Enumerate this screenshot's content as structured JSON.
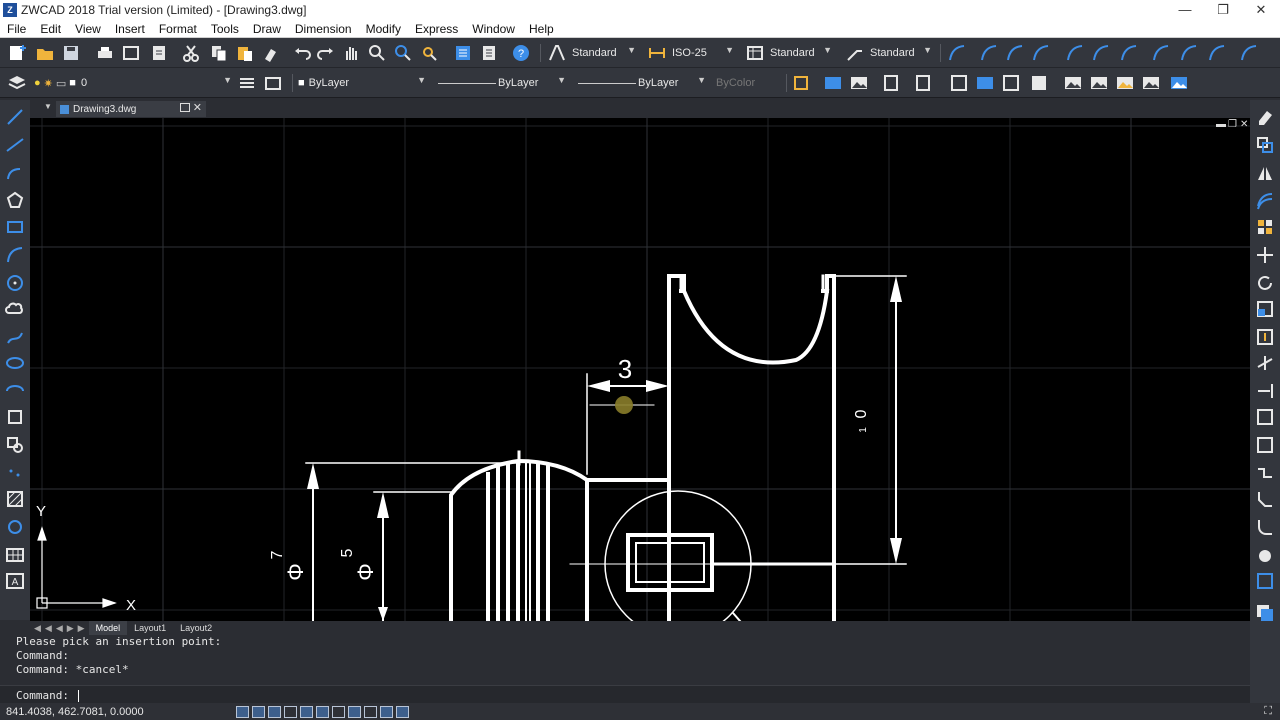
{
  "window": {
    "icon_text": "Z",
    "title": "ZWCAD 2018 Trial version (Limited) - [Drawing3.dwg]",
    "minimize": "—",
    "restore": "❐",
    "close": "✕"
  },
  "menu": [
    "File",
    "Edit",
    "View",
    "Insert",
    "Format",
    "Tools",
    "Draw",
    "Dimension",
    "Modify",
    "Express",
    "Window",
    "Help"
  ],
  "toolbar_styles": {
    "text_style": "Standard",
    "dim_style": "ISO-25",
    "table_style": "Standard",
    "multileader_style": "Standard"
  },
  "properties": {
    "layer": "0",
    "color": "ByLayer",
    "linetype": "ByLayer",
    "lineweight": "ByLayer",
    "plotstyle": "ByColor"
  },
  "document_tab": {
    "label": "Drawing3.dwg",
    "close": "✕"
  },
  "layout_tabs": [
    "Model",
    "Layout1",
    "Layout2"
  ],
  "layout_nav": "◀◀◀▶▶",
  "drawing": {
    "dim_top": "3",
    "dim_right": "0",
    "dim_right_sub": "1",
    "dim_left_1": "7",
    "dim_left_2": "5",
    "diameter_symbol": "Φ",
    "ucs_x": "X",
    "ucs_y": "Y"
  },
  "canvas_controls": {
    "minimize": "▬",
    "restore": "❐",
    "close": "✕"
  },
  "command": {
    "history": [
      "Please pick an insertion point:",
      "Command:",
      "Command: *cancel*"
    ],
    "prompt": "Command:"
  },
  "status": {
    "coords": "841.4038, 462.7081, 0.0000"
  },
  "colors": {
    "accent": "#3d8ee8",
    "canvas": "#000000",
    "panel": "#33363d"
  }
}
